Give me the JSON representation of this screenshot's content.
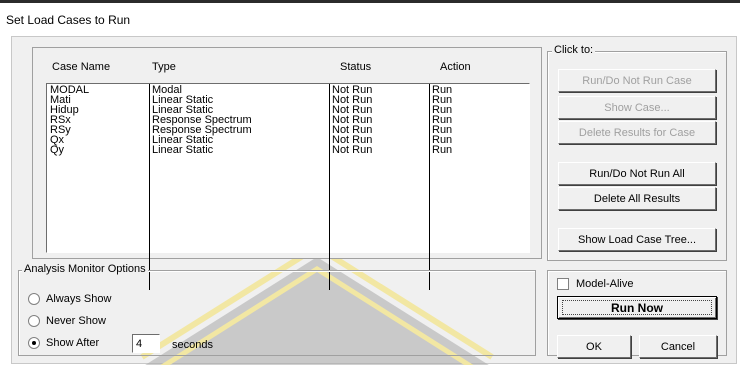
{
  "window": {
    "title": "Set Load Cases to Run"
  },
  "table": {
    "headers": [
      "Case Name",
      "Type",
      "Status",
      "Action"
    ],
    "rows": [
      [
        "MODAL",
        "Modal",
        "Not Run",
        "Run"
      ],
      [
        "Mati",
        "Linear Static",
        "Not Run",
        "Run"
      ],
      [
        "Hidup",
        "Linear Static",
        "Not Run",
        "Run"
      ],
      [
        "RSx",
        "Response Spectrum",
        "Not Run",
        "Run"
      ],
      [
        "RSy",
        "Response Spectrum",
        "Not Run",
        "Run"
      ],
      [
        "Qx",
        "Linear Static",
        "Not Run",
        "Run"
      ],
      [
        "Qy",
        "Linear Static",
        "Not Run",
        "Run"
      ]
    ]
  },
  "click_to": {
    "label": "Click to:",
    "run_do_not_run_case": "Run/Do Not Run Case",
    "show_case": "Show Case...",
    "delete_results_for_case": "Delete Results for Case",
    "run_do_not_run_all": "Run/Do Not Run All",
    "delete_all_results": "Delete All Results",
    "show_load_case_tree": "Show Load Case Tree..."
  },
  "monitor": {
    "label": "Analysis Monitor Options",
    "always_show": "Always Show",
    "never_show": "Never Show",
    "show_after": "Show After",
    "seconds_value": "4",
    "seconds_label": "seconds",
    "selected": "Show After"
  },
  "model_alive": {
    "label": "Model-Alive",
    "checked": false
  },
  "run_now": "Run Now",
  "ok": "OK",
  "cancel": "Cancel",
  "colors": {
    "dialog_bg": "#f0f0f0",
    "watermark": "#f2e7a3"
  }
}
